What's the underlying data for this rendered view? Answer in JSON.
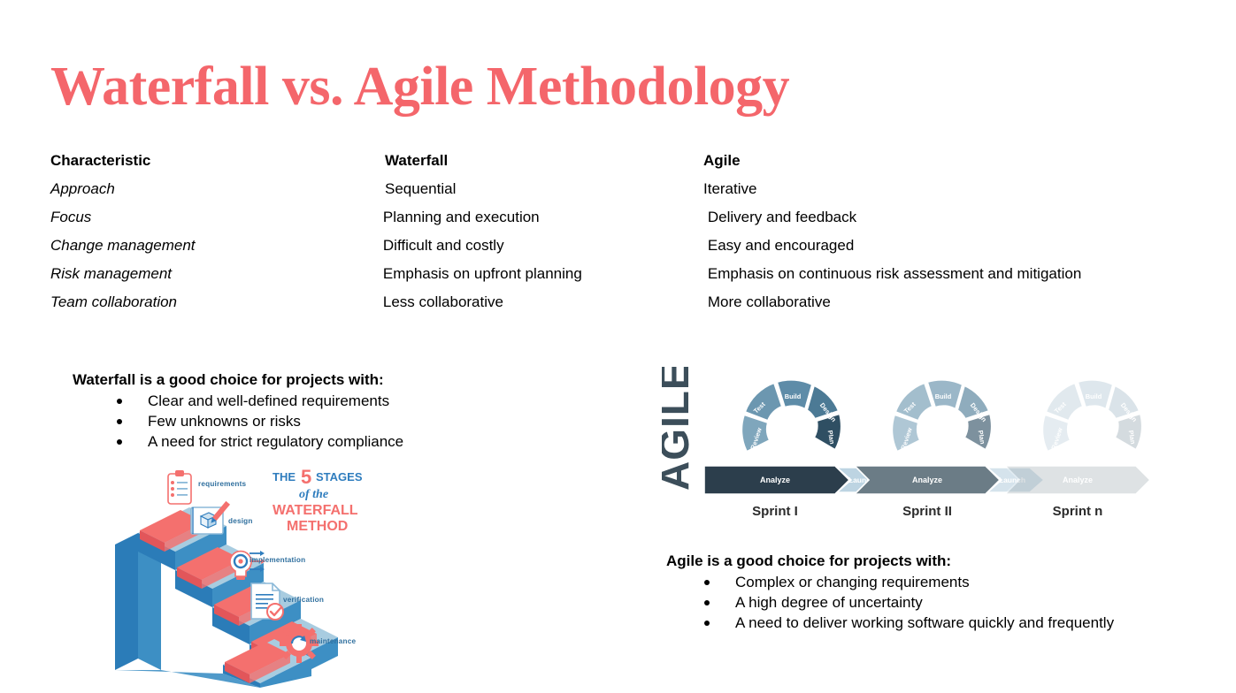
{
  "title": "Waterfall vs. Agile Methodology",
  "theme": {
    "title_color": "#F4666B",
    "waterfall_red": "#F4706E",
    "waterfall_blue": "#2F7DBE",
    "agile_dark": "#2C3E4C",
    "agile_slate": "#3C4E5A"
  },
  "table": {
    "headers": {
      "characteristic": "Characteristic",
      "waterfall": "Waterfall",
      "agile": "Agile"
    },
    "rows": [
      {
        "characteristic": "Approach",
        "waterfall": "Sequential",
        "agile": "Iterative"
      },
      {
        "characteristic": "Focus",
        "waterfall": "Planning and execution",
        "agile": "Delivery and feedback"
      },
      {
        "characteristic": "Change management",
        "waterfall": "Difficult and costly",
        "agile": "Easy and encouraged"
      },
      {
        "characteristic": "Risk management",
        "waterfall": "Emphasis on upfront planning",
        "agile": "Emphasis on continuous risk assessment and mitigation"
      },
      {
        "characteristic": "Team collaboration",
        "waterfall": "Less collaborative",
        "agile": "More collaborative"
      }
    ]
  },
  "waterfall_panel": {
    "heading": "Waterfall is a good choice for projects with:",
    "bullets": [
      "Clear and well-defined requirements",
      "Few unknowns or risks",
      "A need for strict regulatory compliance"
    ]
  },
  "agile_panel": {
    "heading": "Agile is a good choice for projects with:",
    "bullets": [
      "Complex or changing requirements",
      "A high degree of uncertainty",
      "A need to deliver working software quickly and frequently"
    ]
  },
  "waterfall_figure": {
    "headline_line1_a": "THE",
    "headline_line1_b": "5",
    "headline_line1_c": "STAGES",
    "headline_line2": "of the",
    "headline_line3": "WATERFALL",
    "headline_line4": "METHOD",
    "stages": [
      "requirements",
      "design",
      "implementation",
      "verification",
      "maintenance"
    ]
  },
  "agile_figure": {
    "word": "AGILE",
    "segments": [
      "Build",
      "Design",
      "Plan",
      "Analyze",
      "Review",
      "Test"
    ],
    "connector": "Launch",
    "sprints": [
      "Sprint I",
      "Sprint II",
      "Sprint n"
    ]
  }
}
